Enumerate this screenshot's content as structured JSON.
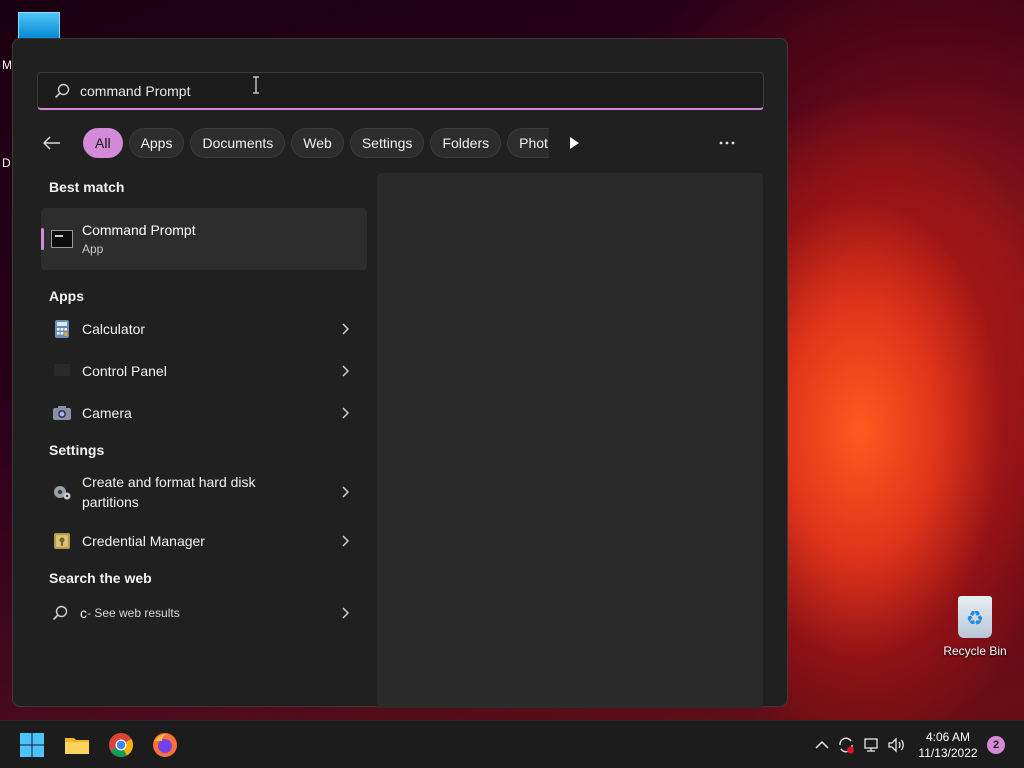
{
  "desktop": {
    "frag_m": "M",
    "frag_d": "D",
    "recycle_bin_label": "Recycle Bin"
  },
  "search": {
    "query": "command Prompt"
  },
  "filters": [
    "All",
    "Apps",
    "Documents",
    "Web",
    "Settings",
    "Folders",
    "Phot"
  ],
  "sections": {
    "best_match": "Best match",
    "apps": "Apps",
    "settings": "Settings",
    "web": "Search the web"
  },
  "best_match": {
    "title": "Command Prompt",
    "subtitle": "App"
  },
  "apps": [
    {
      "label": "Calculator"
    },
    {
      "label": "Control Panel"
    },
    {
      "label": "Camera"
    }
  ],
  "settings": [
    {
      "label": "Create and format hard disk partitions"
    },
    {
      "label": "Credential Manager"
    }
  ],
  "web_result": {
    "term": "c",
    "suffix": " - See web results"
  },
  "taskbar": {
    "time": "4:06 AM",
    "date": "11/13/2022",
    "notification_count": "2"
  },
  "colors": {
    "accent": "#d38ad8",
    "panel": "#202020"
  }
}
